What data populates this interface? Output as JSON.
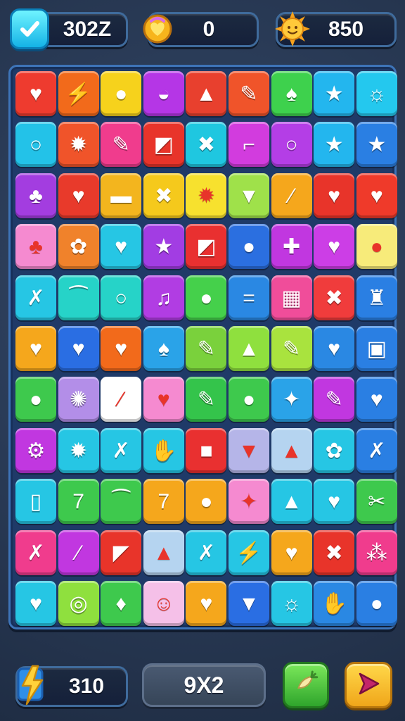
{
  "hud": {
    "moves": {
      "icon": "checkmark-icon",
      "value": "302Z"
    },
    "coins": {
      "icon": "heart-coin-icon",
      "value": "0"
    },
    "score": {
      "icon": "smiling-sun-icon",
      "value": "850"
    }
  },
  "board": {
    "columns": 9,
    "rows": [
      [
        {
          "c": "#ee3b2f",
          "g": "♥",
          "n": "heart"
        },
        {
          "c": "#f26a1b",
          "g": "⚡",
          "n": "bolt"
        },
        {
          "c": "#f6d21c",
          "g": "●",
          "n": "ball"
        },
        {
          "c": "#b536e6",
          "g": "◒",
          "n": "bowl"
        },
        {
          "c": "#e8402e",
          "g": "▲",
          "n": "bell"
        },
        {
          "c": "#f0542a",
          "g": "✎",
          "n": "pencil"
        },
        {
          "c": "#3ed14d",
          "g": "♠",
          "n": "leaf"
        },
        {
          "c": "#23b6ee",
          "g": "★",
          "n": "star"
        },
        {
          "c": "#24c8ee",
          "g": "☼",
          "n": "sun"
        }
      ],
      [
        {
          "c": "#23c2e8",
          "g": "○",
          "n": "ring"
        },
        {
          "c": "#f0542a",
          "g": "✹",
          "n": "sun"
        },
        {
          "c": "#f03c8d",
          "g": "✎",
          "n": "pencil"
        },
        {
          "c": "#e8342a",
          "g": "◩",
          "n": "box"
        },
        {
          "c": "#1fc7e0",
          "g": "✖",
          "n": "cross"
        },
        {
          "c": "#d23cde",
          "g": "⌐",
          "n": "hammer"
        },
        {
          "c": "#b43ee6",
          "g": "○",
          "n": "ring"
        },
        {
          "c": "#23b6ee",
          "g": "★",
          "n": "star"
        },
        {
          "c": "#2a7fe3",
          "g": "★",
          "n": "star"
        }
      ],
      [
        {
          "c": "#a33de0",
          "g": "♣",
          "n": "leaf"
        },
        {
          "c": "#e83a2b",
          "g": "♥",
          "n": "heart"
        },
        {
          "c": "#f3b51e",
          "g": "▬",
          "n": "flag"
        },
        {
          "c": "#f5c91c",
          "g": "✖",
          "n": "cross"
        },
        {
          "c": "#f7e12e",
          "g": "✹",
          "n": "splat"
        },
        {
          "c": "#9fe14a",
          "g": "▼",
          "n": "cup"
        },
        {
          "c": "#f5a71c",
          "g": "⁄",
          "n": "wand"
        },
        {
          "c": "#e8342a",
          "g": "♥",
          "n": "heart"
        },
        {
          "c": "#ef3a2a",
          "g": "♥",
          "n": "heart"
        }
      ],
      [
        {
          "c": "#f58ad0",
          "g": "♣",
          "n": "cloud"
        },
        {
          "c": "#f0822b",
          "g": "✿",
          "n": "flower"
        },
        {
          "c": "#26c6e4",
          "g": "♥",
          "n": "heart"
        },
        {
          "c": "#a23de3",
          "g": "★",
          "n": "star"
        },
        {
          "c": "#e93030",
          "g": "◩",
          "n": "box"
        },
        {
          "c": "#2b6fe0",
          "g": "●",
          "n": "ball"
        },
        {
          "c": "#c137e0",
          "g": "✚",
          "n": "candy"
        },
        {
          "c": "#cc3ee6",
          "g": "♥",
          "n": "heart"
        },
        {
          "c": "#f7eb7a",
          "g": "●",
          "n": "ball"
        }
      ],
      [
        {
          "c": "#26c6e4",
          "g": "✗",
          "n": "cross"
        },
        {
          "c": "#26d3c8",
          "g": "⁀",
          "n": "bean"
        },
        {
          "c": "#26d3c8",
          "g": "○",
          "n": "ring"
        },
        {
          "c": "#b13de3",
          "g": "♫",
          "n": "note"
        },
        {
          "c": "#45d04b",
          "g": "●",
          "n": "blob"
        },
        {
          "c": "#2a88e3",
          "g": "=",
          "n": "equal"
        },
        {
          "c": "#f04d9a",
          "g": "▦",
          "n": "grid"
        },
        {
          "c": "#f03c3c",
          "g": "✖",
          "n": "cross"
        },
        {
          "c": "#2a7fe3",
          "g": "♜",
          "n": "jar"
        }
      ],
      [
        {
          "c": "#f5a71c",
          "g": "♥",
          "n": "heart"
        },
        {
          "c": "#2a6ee3",
          "g": "♥",
          "n": "heart"
        },
        {
          "c": "#f26a1b",
          "g": "♥",
          "n": "heart"
        },
        {
          "c": "#2aa3e8",
          "g": "♠",
          "n": "blob"
        },
        {
          "c": "#7ad13c",
          "g": "✎",
          "n": "pencil"
        },
        {
          "c": "#8fe03e",
          "g": "▲",
          "n": "cone"
        },
        {
          "c": "#a9e33e",
          "g": "✎",
          "n": "pencil"
        },
        {
          "c": "#2a88e3",
          "g": "♥",
          "n": "heart"
        },
        {
          "c": "#2a7fe3",
          "g": "▣",
          "n": "box"
        }
      ],
      [
        {
          "c": "#3ec94d",
          "g": "●",
          "n": "blob"
        },
        {
          "c": "#b38ee8",
          "g": "✺",
          "n": "sun"
        },
        {
          "c": "#ffffff",
          "g": "⁄",
          "n": "wand"
        },
        {
          "c": "#f58ad0",
          "g": "♥",
          "n": "heart"
        },
        {
          "c": "#34c44b",
          "g": "✎",
          "n": "pencil"
        },
        {
          "c": "#3ec94d",
          "g": "●",
          "n": "blob"
        },
        {
          "c": "#2aa3e8",
          "g": "✦",
          "n": "star"
        },
        {
          "c": "#c137e0",
          "g": "✎",
          "n": "pencil"
        },
        {
          "c": "#2a7fe3",
          "g": "♥",
          "n": "heart"
        }
      ],
      [
        {
          "c": "#c137e0",
          "g": "⚙",
          "n": "gear"
        },
        {
          "c": "#26c6e4",
          "g": "✹",
          "n": "sun"
        },
        {
          "c": "#26c6e4",
          "g": "✗",
          "n": "cross"
        },
        {
          "c": "#26c6e4",
          "g": "✋",
          "n": "hand"
        },
        {
          "c": "#e93030",
          "g": "■",
          "n": "square"
        },
        {
          "c": "#b5b5e8",
          "g": "▼",
          "n": "cup"
        },
        {
          "c": "#b5d4f0",
          "g": "▲",
          "n": "cone"
        },
        {
          "c": "#26c6e4",
          "g": "✿",
          "n": "leaf"
        },
        {
          "c": "#2a7fe3",
          "g": "✗",
          "n": "cross"
        }
      ],
      [
        {
          "c": "#26c6e4",
          "g": "▯",
          "n": "jar"
        },
        {
          "c": "#3ec94d",
          "g": "7",
          "n": "seven"
        },
        {
          "c": "#3ec94d",
          "g": "⁀",
          "n": "bean"
        },
        {
          "c": "#f5a71c",
          "g": "7",
          "n": "seven"
        },
        {
          "c": "#f5a71c",
          "g": "●",
          "n": "ball"
        },
        {
          "c": "#f58ad0",
          "g": "✦",
          "n": "sparkle"
        },
        {
          "c": "#26c6e4",
          "g": "▲",
          "n": "drop"
        },
        {
          "c": "#26c6e4",
          "g": "♥",
          "n": "heart"
        },
        {
          "c": "#3ec94d",
          "g": "✂",
          "n": "scissors"
        }
      ],
      [
        {
          "c": "#f03c8d",
          "g": "✗",
          "n": "cross"
        },
        {
          "c": "#c137e0",
          "g": "⁄",
          "n": "wand"
        },
        {
          "c": "#e8342a",
          "g": "◤",
          "n": "flag"
        },
        {
          "c": "#b5d4f0",
          "g": "▲",
          "n": "cone"
        },
        {
          "c": "#26c6e4",
          "g": "✗",
          "n": "cross"
        },
        {
          "c": "#26c6e4",
          "g": "⚡",
          "n": "bolt"
        },
        {
          "c": "#f5a71c",
          "g": "♥",
          "n": "heart"
        },
        {
          "c": "#e8342a",
          "g": "✖",
          "n": "cross"
        },
        {
          "c": "#f03c8d",
          "g": "⁂",
          "n": "grapes"
        }
      ],
      [
        {
          "c": "#26c6e4",
          "g": "♥",
          "n": "heart"
        },
        {
          "c": "#8fe03e",
          "g": "◎",
          "n": "target"
        },
        {
          "c": "#3ec94d",
          "g": "♦",
          "n": "gem"
        },
        {
          "c": "#f5c0e8",
          "g": "☺",
          "n": "smiley"
        },
        {
          "c": "#f5a71c",
          "g": "♥",
          "n": "heart"
        },
        {
          "c": "#2a6ee3",
          "g": "▼",
          "n": "cup"
        },
        {
          "c": "#26c6e4",
          "g": "☼",
          "n": "sun"
        },
        {
          "c": "#2a88e3",
          "g": "✋",
          "n": "hand"
        },
        {
          "c": "#2a7fe3",
          "g": "●",
          "n": "ball"
        }
      ]
    ]
  },
  "footer": {
    "power": {
      "icon": "lightning-ticket-icon",
      "value": "310"
    },
    "grid_label": "9X2",
    "hint": {
      "icon": "carrot-hint-icon"
    },
    "play": {
      "icon": "play-arrow-icon"
    }
  },
  "colors": {
    "background": "#2b3c55",
    "board": "#1f3a68",
    "board_border": "#3e74b8",
    "play_button": "#f5c21c",
    "hint_button": "#4dcf3e"
  }
}
